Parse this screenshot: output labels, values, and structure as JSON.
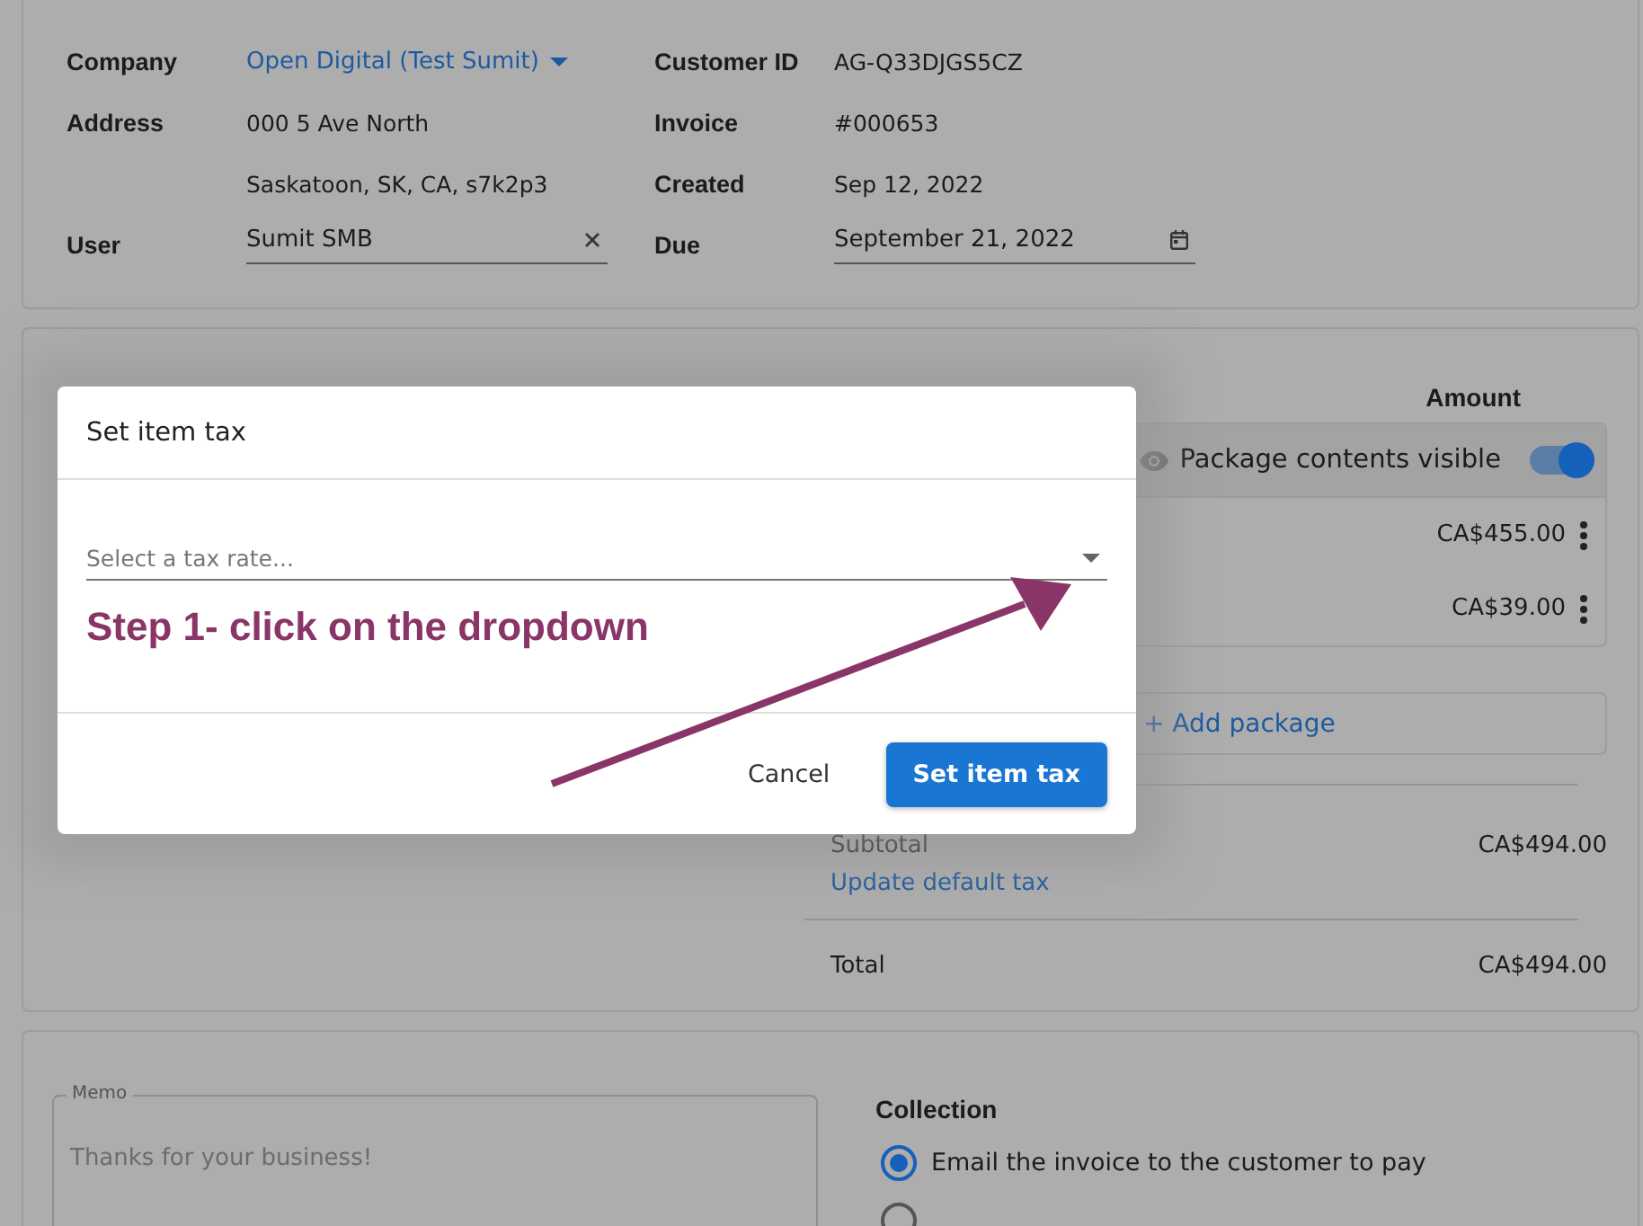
{
  "header": {
    "company": {
      "label": "Company",
      "value": "Open Digital (Test Sumit)"
    },
    "address": {
      "label": "Address",
      "lines": [
        "000 5 Ave North",
        "Saskatoon, SK, CA, s7k2p3"
      ]
    },
    "user": {
      "label": "User",
      "value": "Sumit SMB"
    },
    "customer_id": {
      "label": "Customer ID",
      "value": "AG-Q33DJGS5CZ"
    },
    "invoice": {
      "label": "Invoice",
      "value": "#000653"
    },
    "created": {
      "label": "Created",
      "value": "Sep 12, 2022"
    },
    "due": {
      "label": "Due",
      "value": "September 21, 2022"
    }
  },
  "items": {
    "amount_heading": "Amount",
    "package": {
      "visibility_label": "Package contents visible",
      "visible": true,
      "rows": [
        {
          "amount": "CA$455.00"
        },
        {
          "amount": "CA$39.00"
        }
      ]
    },
    "add_package": "+ Add package",
    "subtotal": {
      "label": "Subtotal",
      "value": "CA$494.00",
      "link": "Update default tax"
    },
    "total": {
      "label": "Total",
      "value": "CA$494.00"
    }
  },
  "footer": {
    "memo": {
      "label": "Memo",
      "placeholder": "Thanks for your business!"
    },
    "collection": {
      "heading": "Collection",
      "options": [
        {
          "label": "Email the invoice to the customer to pay",
          "selected": true
        },
        {
          "selected": false
        }
      ]
    }
  },
  "dialog": {
    "title": "Set item tax",
    "select": {
      "placeholder": "Select a tax rate..."
    },
    "buttons": [
      {
        "label": "Cancel",
        "kind": "text"
      },
      {
        "label": "Set item tax",
        "kind": "primary"
      }
    ]
  },
  "annotation": {
    "text": "Step 1- click on the dropdown"
  }
}
